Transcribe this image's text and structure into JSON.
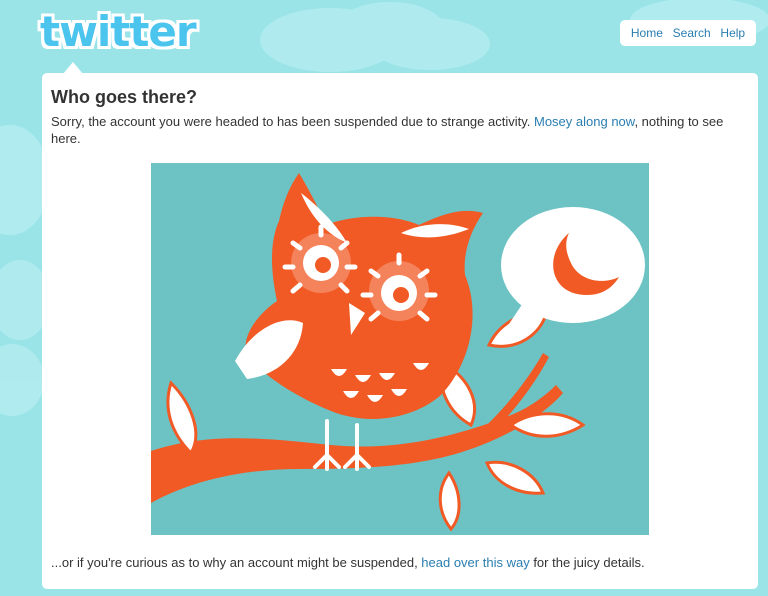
{
  "brand": {
    "logo_text": "twitter",
    "accent_color": "#4bc4ee",
    "background_color": "#9ae4e8"
  },
  "nav": {
    "items": [
      {
        "label": "Home"
      },
      {
        "label": "Search"
      },
      {
        "label": "Help"
      }
    ]
  },
  "main": {
    "heading": "Who goes there?",
    "intro_before": "Sorry, the account you were headed to has been suspended due to strange activity. ",
    "intro_link": "Mosey along now",
    "intro_after": ", nothing to see here.",
    "illustration": {
      "subject": "owl-on-branch",
      "background_color": "#6dc3c4",
      "owl_color": "#f15a24",
      "speech_bubble_icon": "crescent-moon-icon"
    },
    "footer_before": "...or if you're curious as to why an account might be suspended, ",
    "footer_link": "head over this way",
    "footer_after": " for the juicy details."
  }
}
